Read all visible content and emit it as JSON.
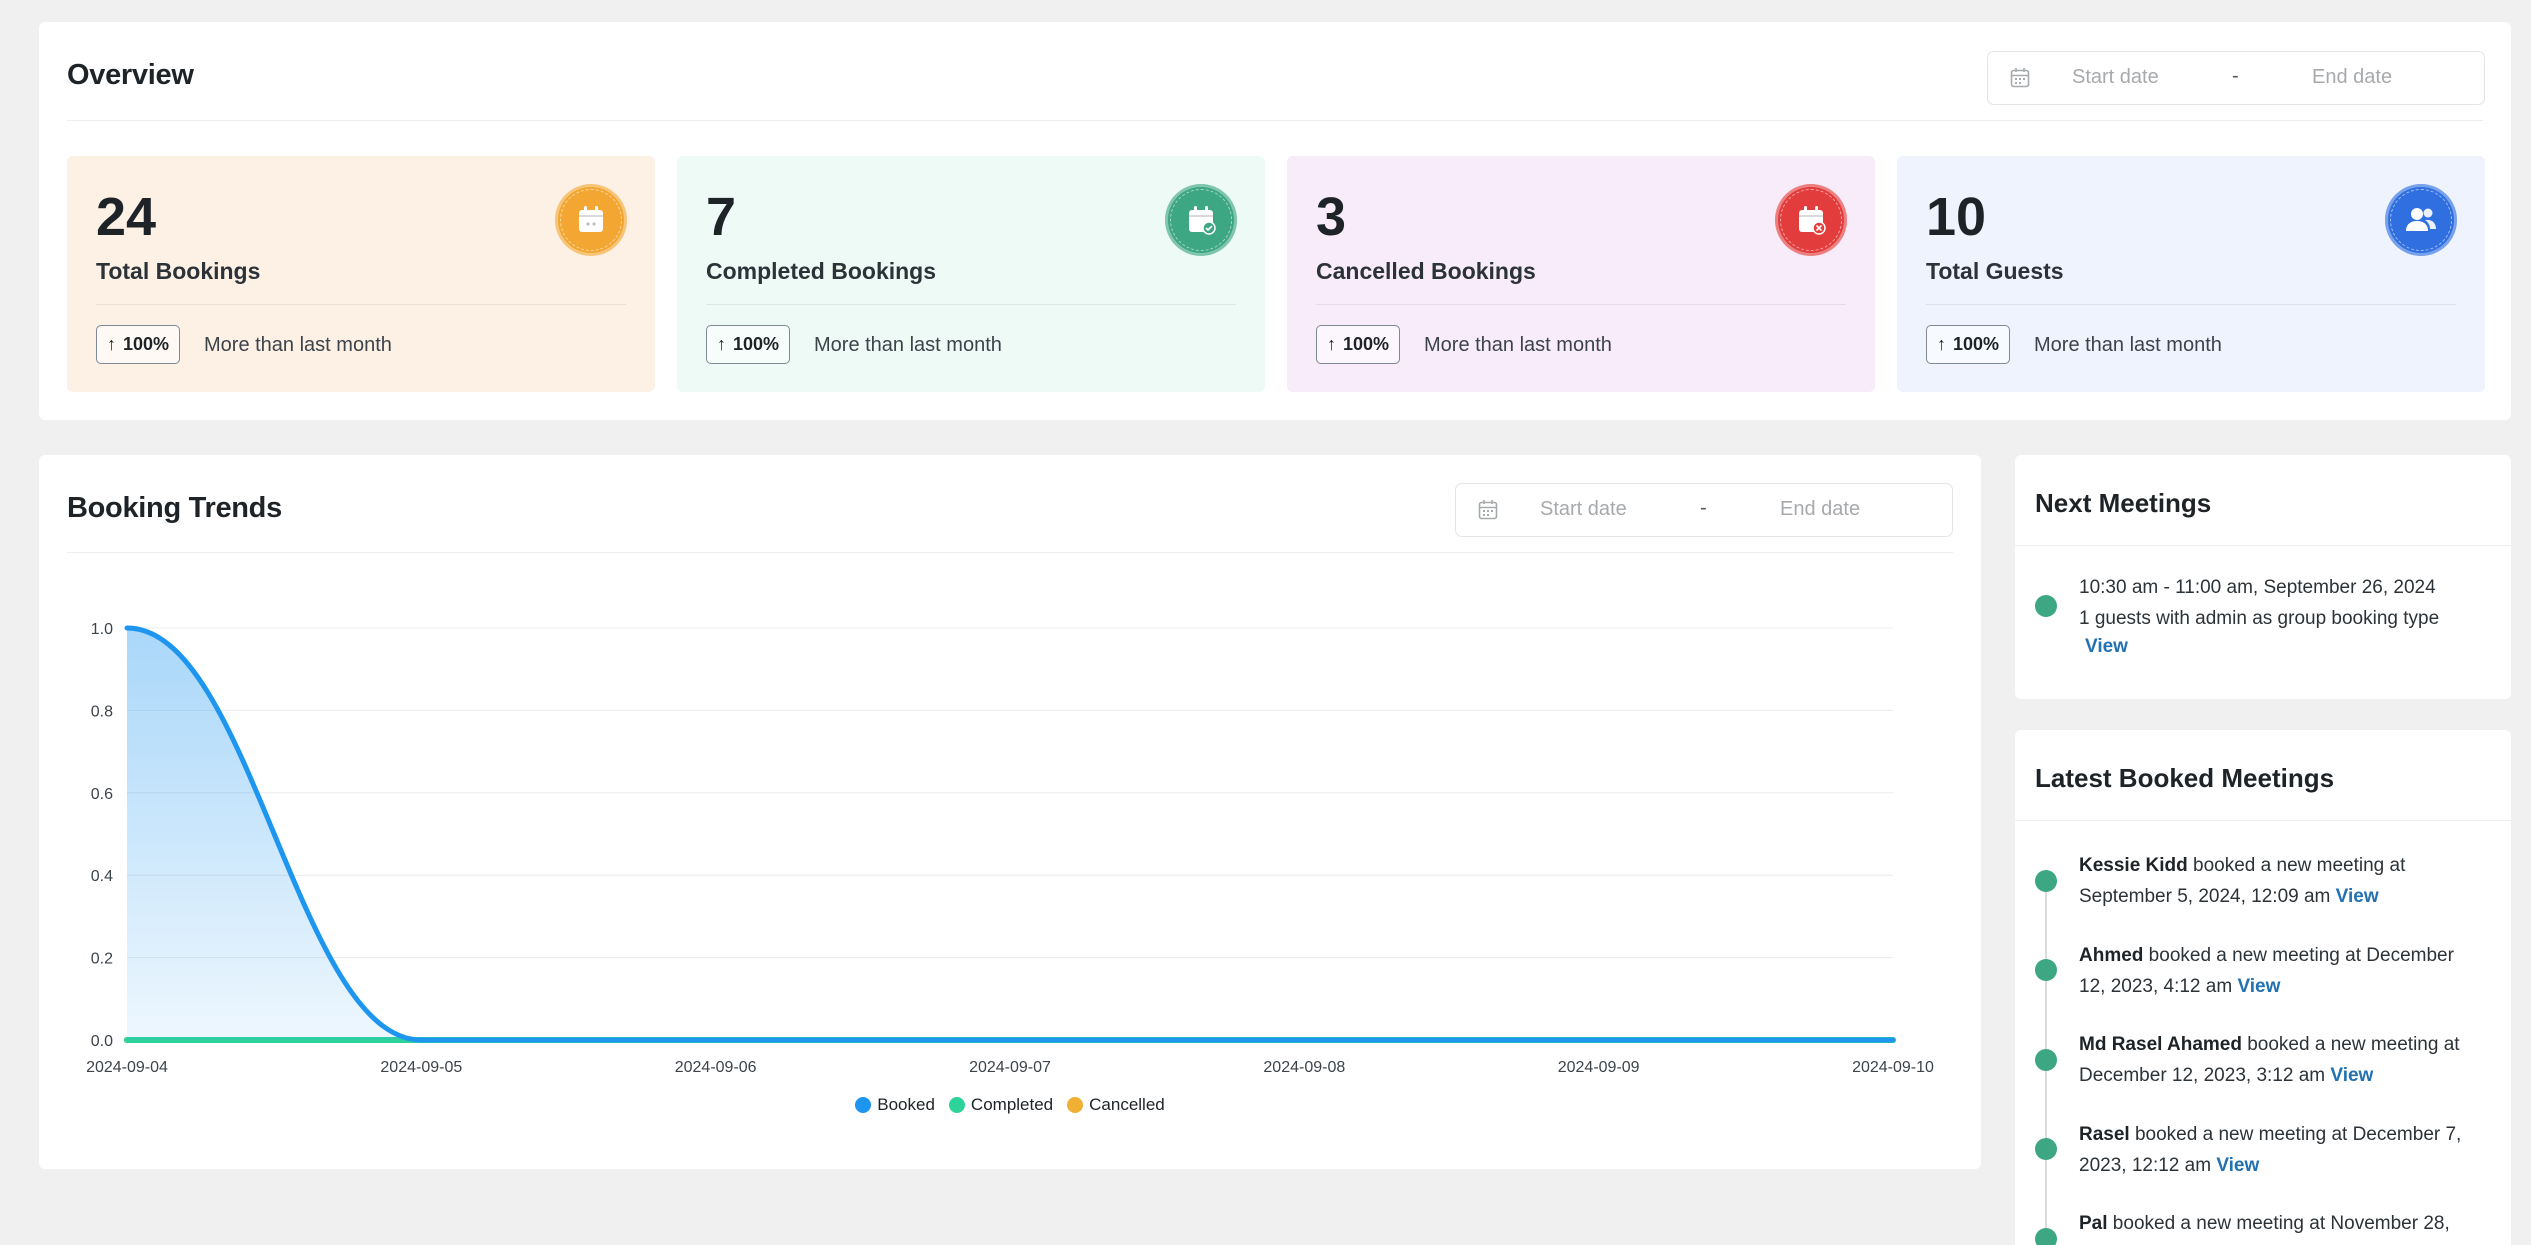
{
  "overview": {
    "title": "Overview",
    "date_range": {
      "start_placeholder": "Start date",
      "separator": "-",
      "end_placeholder": "End date"
    },
    "cards": [
      {
        "value": "24",
        "label": "Total Bookings",
        "change": "100%",
        "compare": "More than last month",
        "icon": "calendar-icon",
        "bg": "#fdf1e6",
        "accent": "#f3a632"
      },
      {
        "value": "7",
        "label": "Completed Bookings",
        "change": "100%",
        "compare": "More than last month",
        "icon": "calendar-check-icon",
        "bg": "#eefaf5",
        "accent": "#3da682"
      },
      {
        "value": "3",
        "label": "Cancelled Bookings",
        "change": "100%",
        "compare": "More than last month",
        "icon": "calendar-cancel-icon",
        "bg": "#f8ecfb",
        "accent": "#e23c3c"
      },
      {
        "value": "10",
        "label": "Total Guests",
        "change": "100%",
        "compare": "More than last month",
        "icon": "users-icon",
        "bg": "#eef3fd",
        "accent": "#2f6fdf"
      }
    ]
  },
  "trends": {
    "title": "Booking Trends",
    "date_range": {
      "start_placeholder": "Start date",
      "separator": "-",
      "end_placeholder": "End date"
    }
  },
  "chart_data": {
    "type": "area",
    "x": [
      "2024-09-04",
      "2024-09-05",
      "2024-09-06",
      "2024-09-07",
      "2024-09-08",
      "2024-09-09",
      "2024-09-10"
    ],
    "yticks": [
      "1.0",
      "0.8",
      "0.6",
      "0.4",
      "0.2",
      "0.0"
    ],
    "ylim": [
      0,
      1
    ],
    "series": [
      {
        "name": "Booked",
        "values": [
          1,
          0,
          0,
          0,
          0,
          0,
          0
        ],
        "color": "#1e96f0"
      },
      {
        "name": "Completed",
        "values": [
          0,
          0,
          0,
          0,
          0,
          0,
          0
        ],
        "color": "#2ed39a"
      },
      {
        "name": "Cancelled",
        "values": [
          0,
          0,
          0,
          0,
          0,
          0,
          0
        ],
        "color": "#f1b034"
      }
    ],
    "grid": true,
    "legend_position": "bottom"
  },
  "next_meetings": {
    "title": "Next Meetings",
    "items": [
      {
        "time": "10:30 am - 11:00 am, September 26, 2024",
        "detail": "1 guests with admin as group booking type",
        "link": "View"
      }
    ]
  },
  "latest_meetings": {
    "title": "Latest Booked Meetings",
    "items": [
      {
        "name": "Kessie Kidd",
        "text_a": " booked a new meeting at",
        "text_b": "September 5, 2024, 12:09 am",
        "link": "View"
      },
      {
        "name": "Ahmed",
        "text_a": " booked a new meeting at December",
        "text_b": "12, 2023, 4:12 am",
        "link": "View"
      },
      {
        "name": "Md Rasel Ahamed",
        "text_a": " booked a new meeting at",
        "text_b": "December 12, 2023, 3:12 am",
        "link": "View"
      },
      {
        "name": "Rasel",
        "text_a": " booked a new meeting at December 7,",
        "text_b": "2023, 12:12 am",
        "link": "View"
      },
      {
        "name": "Pal",
        "text_a": " booked a new meeting at November 28,",
        "text_b": "",
        "link": ""
      }
    ]
  }
}
